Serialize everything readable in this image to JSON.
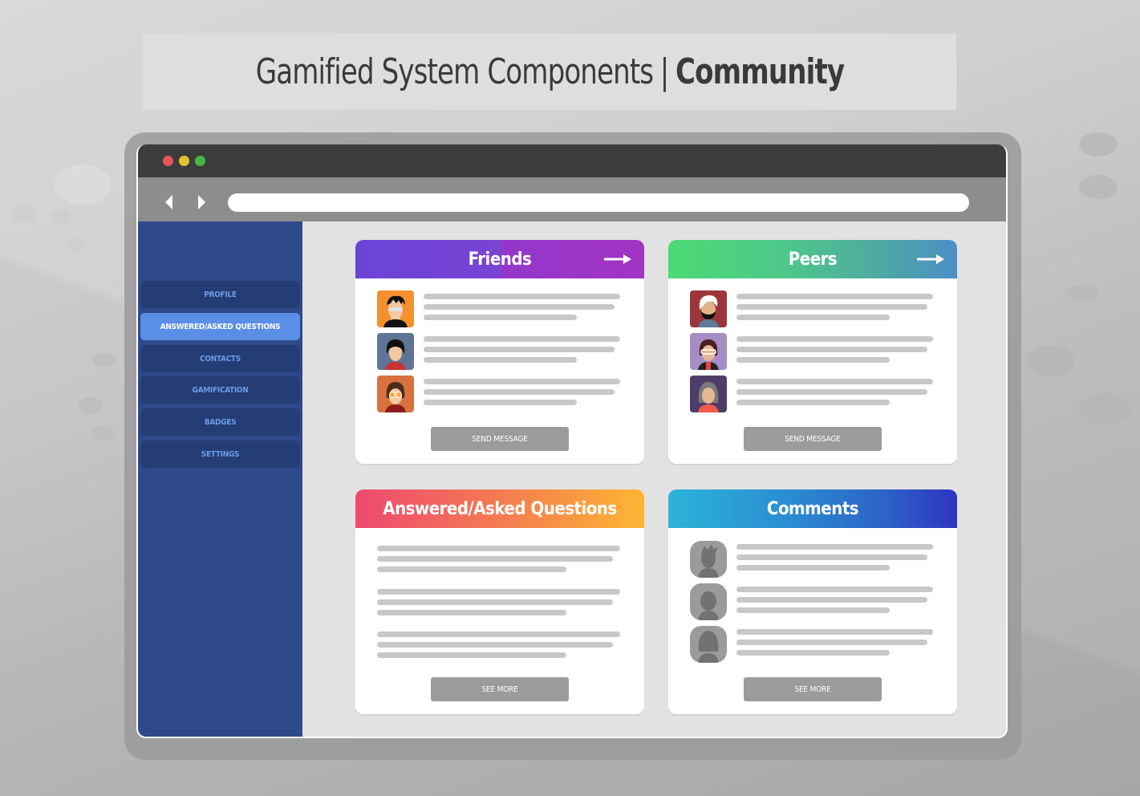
{
  "page": {
    "title_light": "Gamified System Components",
    "title_separator": "|",
    "title_bold": "Community"
  },
  "browser": {
    "window_controls": [
      {
        "name": "close",
        "color": "#e9545a"
      },
      {
        "name": "minimize",
        "color": "#e0c42d"
      },
      {
        "name": "maximize",
        "color": "#42b944"
      }
    ],
    "back_icon": "chevron-left",
    "forward_icon": "chevron-right",
    "address_value": ""
  },
  "sidebar": {
    "items": [
      {
        "label": "Profile",
        "active": false
      },
      {
        "label": "Answered/Asked Questions",
        "active": true
      },
      {
        "label": "Contacts",
        "active": false
      },
      {
        "label": "Gamification",
        "active": false
      },
      {
        "label": "Badges",
        "active": false
      },
      {
        "label": "Settings",
        "active": false
      }
    ]
  },
  "cards": {
    "friends": {
      "title": "Friends",
      "header_gradient": [
        "#6a44d6",
        "#9b36c9"
      ],
      "has_arrow": true,
      "avatars": [
        {
          "bg": "#f5902f",
          "description": "young man with spiky black hair and glasses"
        },
        {
          "bg": "#5f7496",
          "description": "woman with black bob haircut"
        },
        {
          "bg": "#d9713d",
          "description": "woman with orange sunglasses"
        }
      ],
      "button_label": "Send Message"
    },
    "peers": {
      "title": "Peers",
      "header_gradient": [
        "#4cda74",
        "#4c8fc6"
      ],
      "has_arrow": true,
      "avatars": [
        {
          "bg": "#9c363b",
          "description": "man with white hair and black beard"
        },
        {
          "bg": "#a88cc4",
          "description": "woman with glasses and bob hair"
        },
        {
          "bg": "#4e3d68",
          "description": "woman with grey hair"
        }
      ],
      "button_label": "Send Message"
    },
    "questions": {
      "title": "Answered/Asked Questions",
      "header_gradient": [
        "#ed4a6f",
        "#fdb532"
      ],
      "has_arrow": false,
      "text_blocks": 3,
      "button_label": "See More"
    },
    "comments": {
      "title": "Comments",
      "header_gradient": [
        "#2bb3d8",
        "#2e35c2"
      ],
      "has_arrow": false,
      "avatars": [
        {
          "bg": "#9b9b9b",
          "description": "silhouette with spiky hair"
        },
        {
          "bg": "#9b9b9b",
          "description": "silhouette with short hair"
        },
        {
          "bg": "#9b9b9b",
          "description": "silhouette with long hair"
        }
      ],
      "button_label": "See More"
    }
  }
}
